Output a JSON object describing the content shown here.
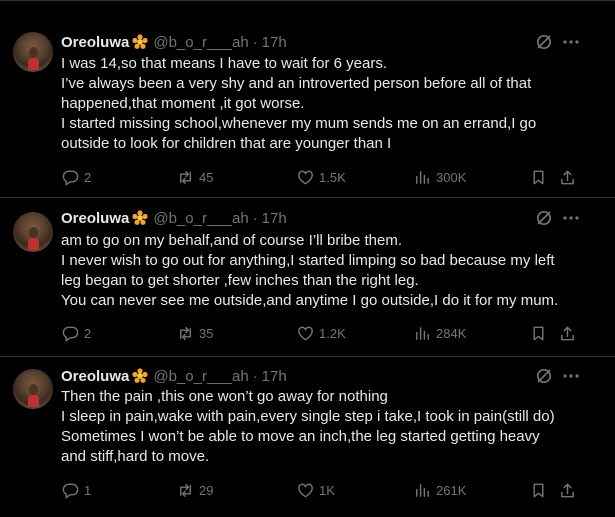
{
  "icon_color": "#71767b",
  "badge_color": "#f4a623",
  "tweets": [
    {
      "name": "Oreoluwa",
      "handle": "@b_o_r___ah",
      "separator": "·",
      "time": "17h",
      "lines": [
        "I was 14,so that means I have to wait for 6 years.",
        "I’ve always been a very shy and an introverted person before all of that",
        "happened,that moment ,it got worse.",
        "I started missing school,whenever my mum sends me on an errand,I go",
        "outside to look for children that are younger than I"
      ],
      "replies": "2",
      "reposts": "45",
      "likes": "1.5K",
      "views": "300K"
    },
    {
      "name": "Oreoluwa",
      "handle": "@b_o_r___ah",
      "separator": "·",
      "time": "17h",
      "lines": [
        "am to go on my behalf,and of course I’ll bribe them.",
        "I never wish to go out for anything,I started limping so bad because my left",
        "leg began to get shorter ,few inches than the right leg.",
        "You can never see me outside,and anytime I go outside,I do it for my mum."
      ],
      "replies": "2",
      "reposts": "35",
      "likes": "1.2K",
      "views": "284K"
    },
    {
      "name": "Oreoluwa",
      "handle": "@b_o_r___ah",
      "separator": "·",
      "time": "17h",
      "lines": [
        "Then the pain ,this one won’t go away for nothing",
        "I sleep in pain,wake with pain,every single step i take,I took in pain(still do)",
        "Sometimes I won’t be able to move an inch,the leg started getting heavy",
        "and stiff,hard to move."
      ],
      "replies": "1",
      "reposts": "29",
      "likes": "1K",
      "views": "261K"
    }
  ]
}
